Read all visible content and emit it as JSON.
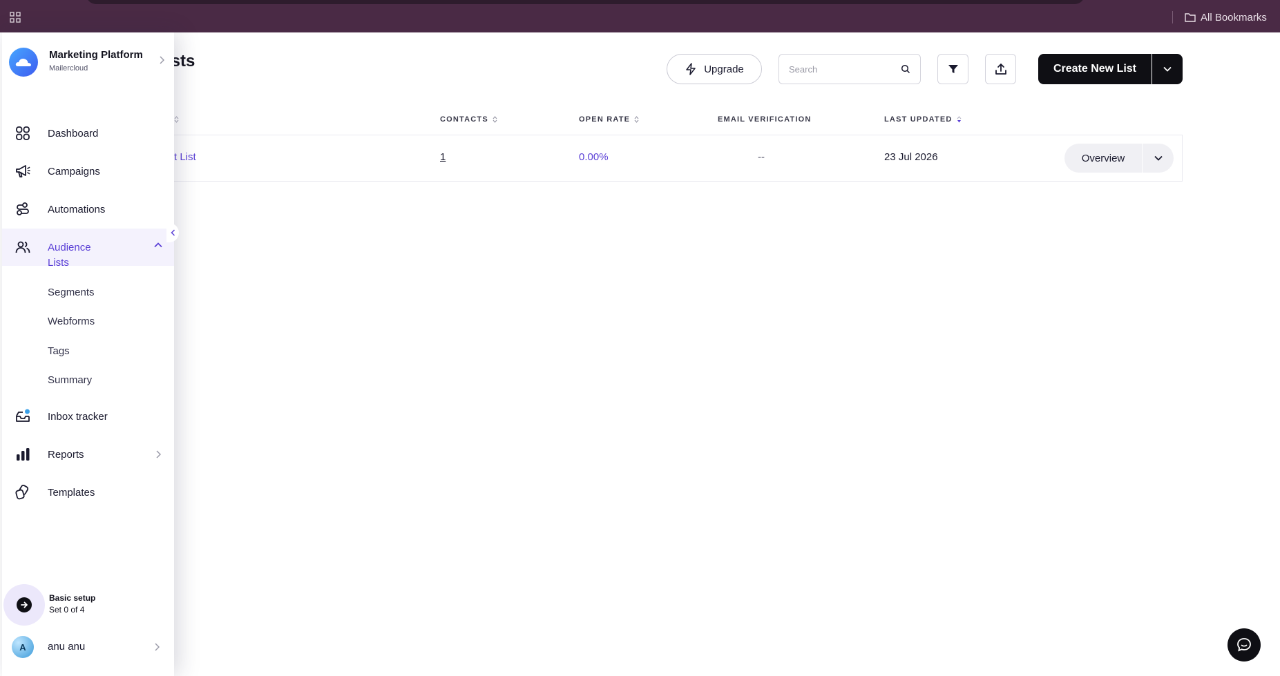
{
  "browser": {
    "bookmarks_label": "All Bookmarks"
  },
  "page": {
    "title": "act Lists"
  },
  "toolbar": {
    "upgrade_label": "Upgrade",
    "search_placeholder": "Search",
    "create_label": "Create New List"
  },
  "table": {
    "columns": [
      "CONTACTS",
      "OPEN RATE",
      "EMAIL VERIFICATION",
      "LAST UPDATED"
    ],
    "rows": [
      {
        "name": "t List",
        "contacts": "1",
        "open_rate": "0.00%",
        "email_verification": "--",
        "last_updated": "23 Jul 2026",
        "action": "Overview"
      }
    ]
  },
  "sidebar": {
    "brand_name": "Marketing Platform",
    "brand_sub": "Mailercloud",
    "items": [
      {
        "label": "Dashboard",
        "icon": "dashboard-icon"
      },
      {
        "label": "Campaigns",
        "icon": "megaphone-icon"
      },
      {
        "label": "Automations",
        "icon": "automation-icon"
      },
      {
        "label": "Audience",
        "icon": "users-icon",
        "active": true
      },
      {
        "label": "Inbox tracker",
        "icon": "inbox-icon"
      },
      {
        "label": "Reports",
        "icon": "bar-chart-icon"
      },
      {
        "label": "Templates",
        "icon": "templates-icon"
      }
    ],
    "audience_sub": [
      "Lists",
      "Segments",
      "Webforms",
      "Tags",
      "Summary"
    ],
    "setup_title": "Basic setup",
    "setup_progress": "Set 0 of 4",
    "user_initial": "A",
    "user_name": "anu anu"
  },
  "colors": {
    "accent": "#5a3fd6",
    "topbar": "#4a2a45",
    "primary_button": "#0f0f14"
  }
}
